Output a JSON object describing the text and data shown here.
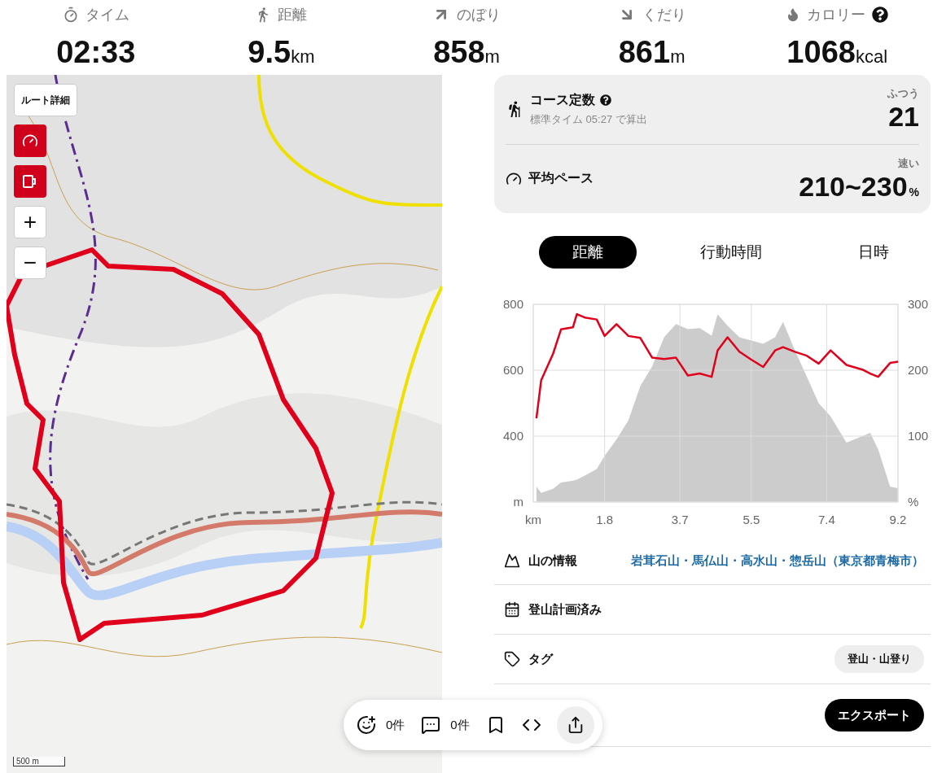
{
  "stats": [
    {
      "kind": "time",
      "label": "タイム",
      "value": "02:33"
    },
    {
      "kind": "distance",
      "label": "距離",
      "value": "9.5",
      "unit": "km"
    },
    {
      "kind": "ascent",
      "label": "のぼり",
      "value": "858",
      "unit": "m"
    },
    {
      "kind": "descent",
      "label": "くだり",
      "value": "861",
      "unit": "m"
    },
    {
      "kind": "calories",
      "label": "カロリー",
      "value": "1068",
      "unit": "kcal"
    }
  ],
  "map": {
    "route_detail_button": "ルート詳細",
    "tools": [
      {
        "kind": "pace"
      },
      {
        "kind": "cup"
      }
    ],
    "zoom_in": "+",
    "zoom_out": "−",
    "scale": "500 m"
  },
  "course_card": {
    "course_constant": {
      "title": "コース定数",
      "subtitle": "標準タイム 05:27 で算出",
      "level_label": "ふつう",
      "value": "21"
    },
    "pace": {
      "title": "平均ペース",
      "level_label": "速い",
      "value": "210~230",
      "unit": "%"
    }
  },
  "tabs": [
    {
      "label": "距離",
      "selected": true
    },
    {
      "label": "行動時間",
      "selected": false
    },
    {
      "label": "日時",
      "selected": false
    }
  ],
  "elevation_chart": {
    "chart_data": {
      "type": "area",
      "grid": true,
      "xlim": [
        0,
        9.2
      ],
      "ylim": [
        200,
        800
      ],
      "xticks": [
        {
          "value": 0,
          "label": "km"
        },
        1.8,
        3.7,
        5.5,
        7.4,
        9.2
      ],
      "yticks": [
        {
          "value": 200,
          "label": "m"
        },
        400,
        600,
        800
      ],
      "x": [
        0.08,
        0.2,
        0.5,
        0.7,
        1.0,
        1.1,
        1.3,
        1.6,
        1.8,
        2.1,
        2.4,
        2.7,
        3.0,
        3.3,
        3.6,
        3.9,
        4.2,
        4.5,
        4.65,
        4.9,
        5.2,
        5.5,
        5.8,
        6.1,
        6.3,
        6.6,
        6.9,
        7.2,
        7.5,
        7.9,
        8.3,
        8.5,
        8.7,
        9.0,
        9.2
      ],
      "series": [
        {
          "color": "#cccccc",
          "values": [
            247,
            228,
            240,
            259,
            265,
            268,
            280,
            300,
            340,
            390,
            448,
            552,
            612,
            700,
            740,
            725,
            728,
            705,
            770,
            735,
            700,
            690,
            680,
            700,
            747,
            660,
            580,
            500,
            460,
            380,
            400,
            410,
            360,
            247,
            242
          ]
        }
      ]
    }
  },
  "pace_chart": {
    "chart_data": {
      "type": "line",
      "xlim": [
        0,
        9.2
      ],
      "ylim": [
        0,
        300
      ],
      "yticks": [
        {
          "value": 0,
          "label": "%"
        },
        100,
        200,
        300
      ],
      "x": [
        0.08,
        0.2,
        0.5,
        0.7,
        1.0,
        1.1,
        1.3,
        1.6,
        1.8,
        2.1,
        2.4,
        2.7,
        3.0,
        3.3,
        3.6,
        3.9,
        4.2,
        4.5,
        4.65,
        4.9,
        5.2,
        5.5,
        5.8,
        6.1,
        6.3,
        6.6,
        6.9,
        7.2,
        7.5,
        7.9,
        8.3,
        8.5,
        8.7,
        9.0,
        9.2
      ],
      "series": [
        {
          "color": "#e0001b",
          "values": [
            127,
            185,
            225,
            262,
            265,
            285,
            280,
            277,
            252,
            270,
            252,
            249,
            219,
            217,
            219,
            192,
            195,
            190,
            230,
            250,
            228,
            216,
            205,
            230,
            235,
            228,
            222,
            210,
            230,
            208,
            201,
            195,
            190,
            211,
            213
          ]
        }
      ]
    }
  },
  "info_rows": [
    {
      "kind": "mountain",
      "label": "山の情報",
      "value": "岩茸石山・馬仏山・高水山・惣岳山（東京都青梅市）"
    },
    {
      "kind": "plan",
      "label": "登山計画済み"
    },
    {
      "kind": "tag",
      "label": "タグ",
      "tags": [
        "登山・山登り"
      ]
    }
  ],
  "export_button": "エクスポート",
  "action_bar": {
    "reactions": "0件",
    "comments": "0件"
  }
}
